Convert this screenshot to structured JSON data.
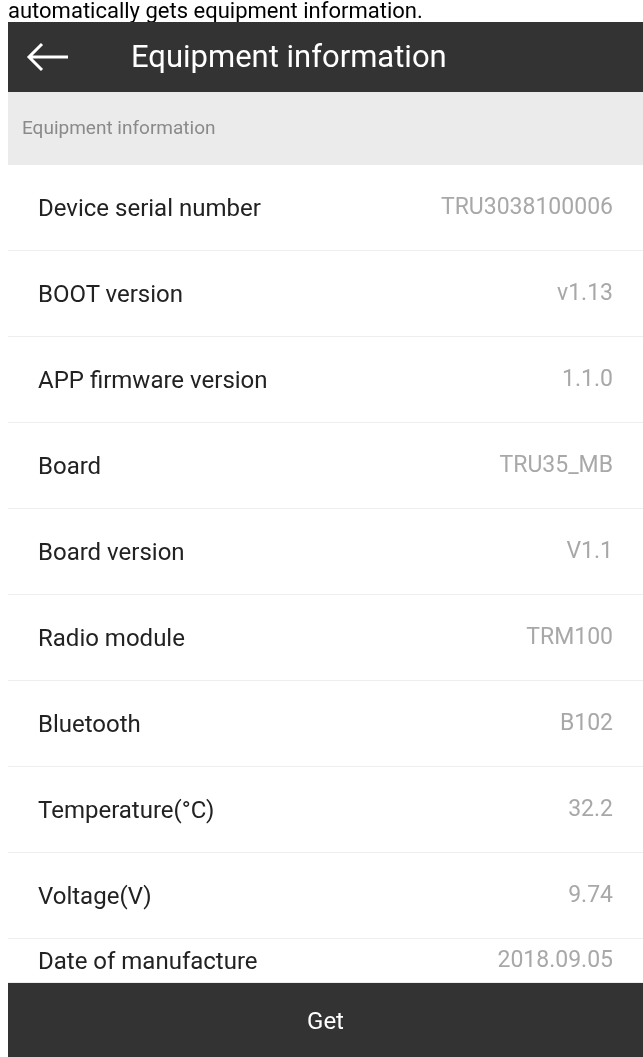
{
  "caption": "automatically gets equipment information.",
  "header": {
    "title": "Equipment information"
  },
  "section": {
    "title": "Equipment information"
  },
  "rows": [
    {
      "label": "Device serial number",
      "value": "TRU3038100006"
    },
    {
      "label": "BOOT version",
      "value": "v1.13"
    },
    {
      "label": "APP firmware version",
      "value": "1.1.0"
    },
    {
      "label": "Board",
      "value": "TRU35_MB"
    },
    {
      "label": "Board version",
      "value": "V1.1"
    },
    {
      "label": "Radio module",
      "value": "TRM100"
    },
    {
      "label": "Bluetooth",
      "value": "B102"
    },
    {
      "label": "Temperature(°C)",
      "value": "32.2"
    },
    {
      "label": "Voltage(V)",
      "value": "9.74"
    },
    {
      "label": "Date of manufacture",
      "value": "2018.09.05"
    }
  ],
  "button": {
    "label": "Get"
  }
}
